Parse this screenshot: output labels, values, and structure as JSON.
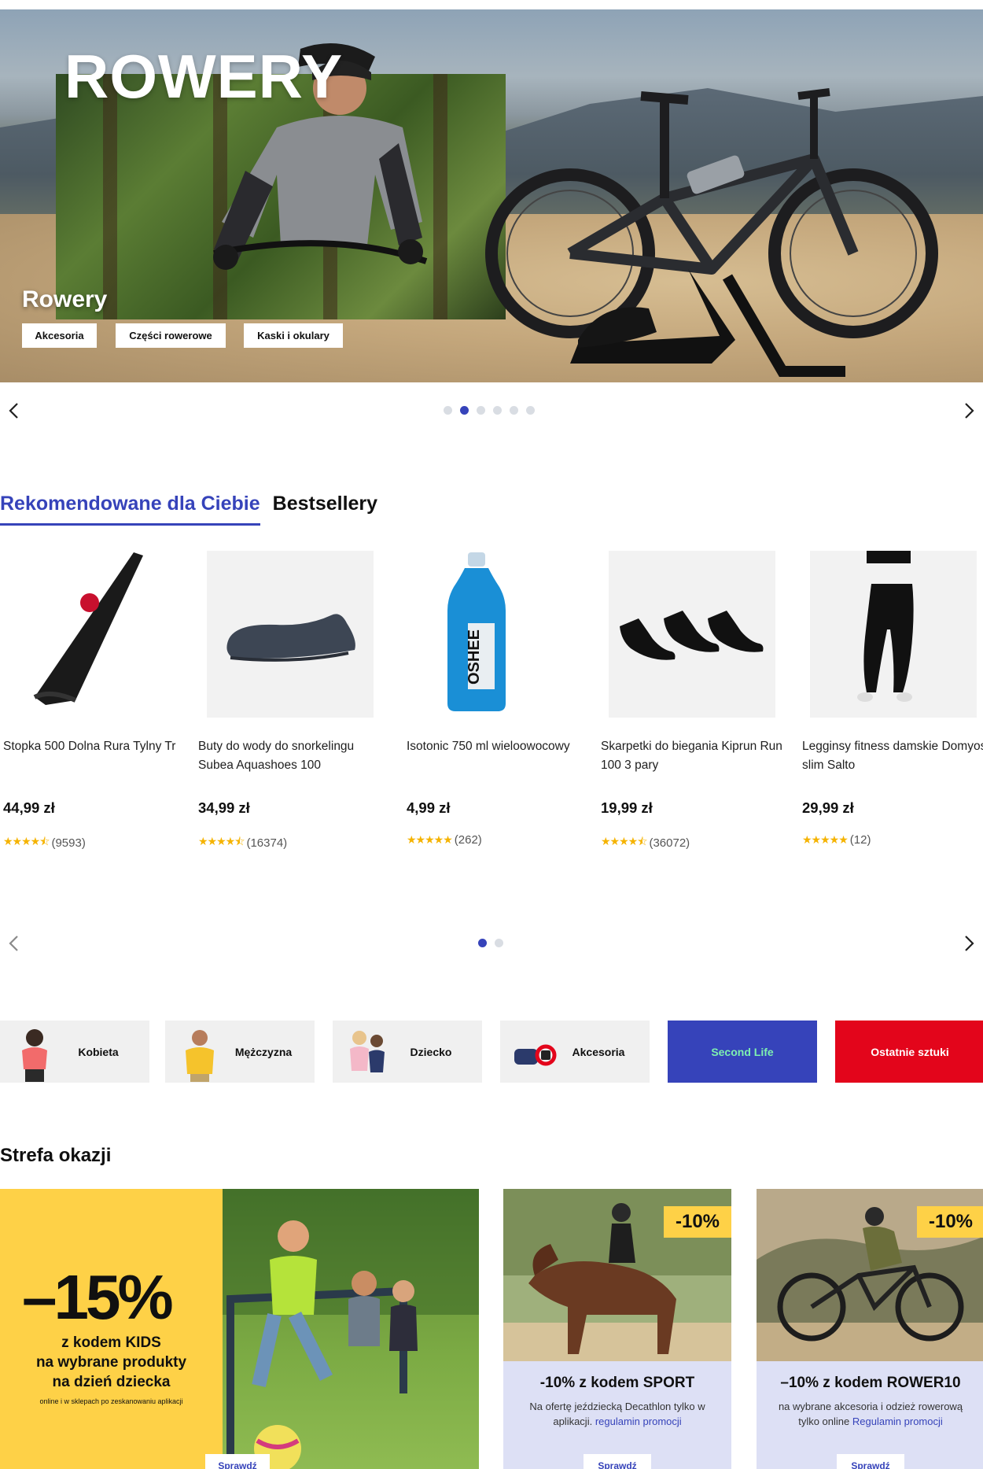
{
  "hero": {
    "title": "ROWERY",
    "subtitle": "Rowery",
    "chips": [
      "Akcesoria",
      "Części rowerowe",
      "Kaski i okulary"
    ],
    "slides_total": 6,
    "active_slide": 2
  },
  "carousel_icons": {
    "prev": "chevron-left-icon",
    "next": "chevron-right-icon"
  },
  "tabs": [
    {
      "label": "Rekomendowane dla Ciebie",
      "active": true
    },
    {
      "label": "Bestsellery",
      "active": false
    }
  ],
  "products": [
    {
      "name": "Stopka 500 Dolna Rura Tylny Tr",
      "price": "44,99 zł",
      "rating": 4.5,
      "reviews": "(9593)"
    },
    {
      "name": "Buty do wody do snorkelingu Subea Aquashoes 100",
      "price": "34,99 zł",
      "rating": 4.5,
      "reviews": "(16374)"
    },
    {
      "name": "Isotonic 750 ml wieloowocowy",
      "price": "4,99 zł",
      "rating": 5,
      "reviews": "(262)"
    },
    {
      "name": "Skarpetki do biegania Kiprun Run 100 3 pary",
      "price": "19,99 zł",
      "rating": 4.5,
      "reviews": "(36072)"
    },
    {
      "name": "Legginsy fitness damskie Domyos slim Salto",
      "price": "29,99 zł",
      "rating": 5,
      "reviews": "(12)"
    }
  ],
  "product_carousel": {
    "pages_total": 2,
    "active_page": 1
  },
  "categories": [
    "Kobieta",
    "Mężczyzna",
    "Dziecko",
    "Akcesoria",
    "Second Life",
    "Ostatnie sztuki"
  ],
  "deals_section": {
    "title": "Strefa okazji",
    "big": {
      "percent": "–15%",
      "line1": "z kodem KIDS",
      "line2": "na wybrane produkty",
      "line3": "na dzień dziecka",
      "line4": "online i w sklepach po zeskanowaniu aplikacji",
      "cta": "Sprawdź"
    },
    "cards": [
      {
        "badge": "-10%",
        "title": "-10% z kodem SPORT",
        "desc": "Na ofertę jeździecką Decathlon tylko w aplikacji.",
        "link": "regulamin promocji",
        "cta": "Sprawdź"
      },
      {
        "badge": "-10%",
        "title": "–10% z kodem ROWER10",
        "desc": "na wybrane akcesoria i odzież rowerową tylko online",
        "link": "Regulamin promocji",
        "cta": "Sprawdź"
      }
    ]
  },
  "colors": {
    "brand_blue": "#3643ba",
    "promo_yellow": "#fed147",
    "promo_red": "#e3051b",
    "star": "#f5b300"
  }
}
